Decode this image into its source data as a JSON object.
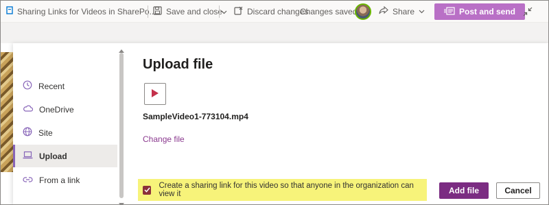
{
  "commandbar": {
    "doc_title": "Sharing Links for Videos in SharePo...",
    "save_close": "Save and close",
    "discard": "Discard changes",
    "status": "Changes saved",
    "share": "Share",
    "post_send": "Post and send"
  },
  "dialog": {
    "nav": [
      {
        "label": "Recent",
        "icon": "clock-icon"
      },
      {
        "label": "OneDrive",
        "icon": "cloud-icon"
      },
      {
        "label": "Site",
        "icon": "globe-icon"
      },
      {
        "label": "Upload",
        "icon": "laptop-icon",
        "active": true
      },
      {
        "label": "From a link",
        "icon": "link-icon"
      }
    ],
    "title": "Upload file",
    "file_name": "SampleVideo1-773104.mp4",
    "change_file": "Change file",
    "sharing_checkbox_label": "Create a sharing link for this video so that anyone in the organization can view it",
    "sharing_checked": true,
    "add_file": "Add file",
    "cancel": "Cancel"
  },
  "colors": {
    "accent": "#8764b8",
    "primary_button": "#7b2c82",
    "post_button": "#b970c6",
    "highlight": "#f7f37a",
    "link": "#8b3a8f"
  }
}
